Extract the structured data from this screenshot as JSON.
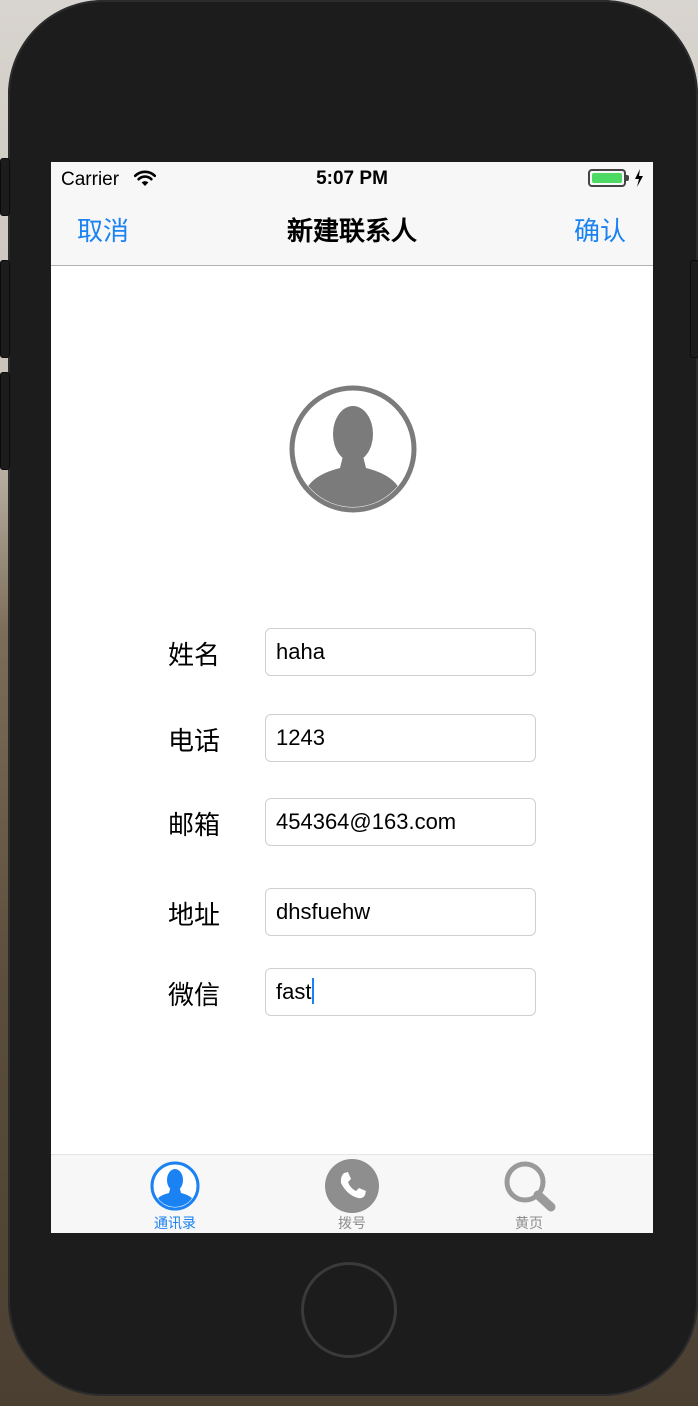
{
  "status_bar": {
    "carrier": "Carrier",
    "time": "5:07 PM",
    "battery_level": 1.0,
    "battery_color": "#4cd964"
  },
  "nav_bar": {
    "cancel_label": "取消",
    "title": "新建联系人",
    "confirm_label": "确认",
    "accent_color": "#1a82f3"
  },
  "avatar": {
    "icon": "person-circle-icon"
  },
  "form": {
    "fields": [
      {
        "label": "姓名",
        "value": "haha"
      },
      {
        "label": "电话",
        "value": "1243"
      },
      {
        "label": "邮箱",
        "value": "454364@163.com"
      },
      {
        "label": "地址",
        "value": "dhsfuehw"
      },
      {
        "label": "微信",
        "value": "fast"
      }
    ]
  },
  "tab_bar": {
    "tabs": [
      {
        "label": "通讯录",
        "icon": "contacts-icon",
        "selected": true
      },
      {
        "label": "拨号",
        "icon": "phone-icon",
        "selected": false
      },
      {
        "label": "黄页",
        "icon": "magnifier-icon",
        "selected": false
      }
    ]
  }
}
